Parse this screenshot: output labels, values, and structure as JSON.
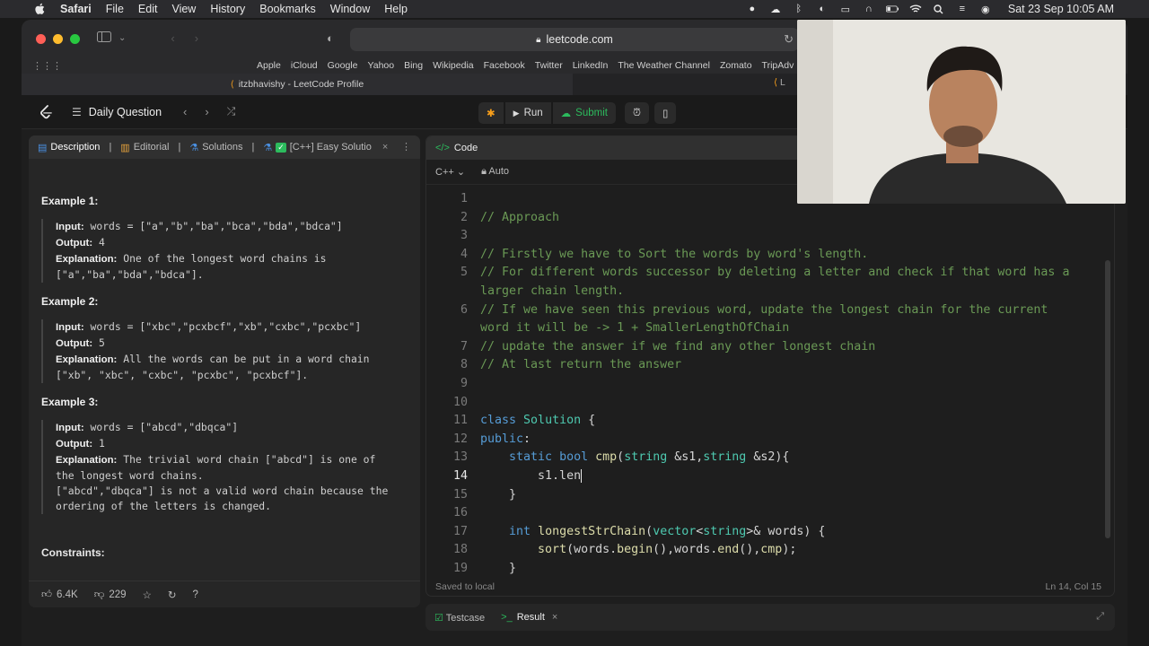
{
  "menubar": {
    "app": "Safari",
    "items": [
      "File",
      "Edit",
      "View",
      "History",
      "Bookmarks",
      "Window",
      "Help"
    ],
    "datetime": "Sat 23 Sep  10:05 AM"
  },
  "browser": {
    "url": "leetcode.com",
    "favorites": [
      "Apple",
      "iCloud",
      "Google",
      "Yahoo",
      "Bing",
      "Wikipedia",
      "Facebook",
      "Twitter",
      "LinkedIn",
      "The Weather Channel",
      "Zomato",
      "TripAdv"
    ],
    "tab_active": "itzbhavishy - LeetCode Profile",
    "tab_other": "L"
  },
  "leetcode": {
    "daily_question": "Daily Question",
    "run_label": "Run",
    "submit_label": "Submit",
    "left_tabs": {
      "description": "Description",
      "editorial": "Editorial",
      "solutions": "Solutions",
      "solution_tab": "[C++] Easy Solutio"
    },
    "examples": [
      {
        "title": "Example 1:",
        "input_label": "Input:",
        "input": " words = [\"a\",\"b\",\"ba\",\"bca\",\"bda\",\"bdca\"]",
        "output_label": "Output:",
        "output": " 4",
        "expl_label": "Explanation:",
        "explanation_l1": " One of the longest word chains is",
        "explanation_l2": "[\"a\",\"ba\",\"bda\",\"bdca\"]."
      },
      {
        "title": "Example 2:",
        "input_label": "Input:",
        "input": " words = [\"xbc\",\"pcxbcf\",\"xb\",\"cxbc\",\"pcxbc\"]",
        "output_label": "Output:",
        "output": " 5",
        "expl_label": "Explanation:",
        "explanation_l1": " All the words can be put in a word chain",
        "explanation_l2": "[\"xb\", \"xbc\", \"cxbc\", \"pcxbc\", \"pcxbcf\"]."
      },
      {
        "title": "Example 3:",
        "input_label": "Input:",
        "input": " words = [\"abcd\",\"dbqca\"]",
        "output_label": "Output:",
        "output": " 1",
        "expl_label": "Explanation:",
        "explanation_l1": " The trivial word chain [\"abcd\"] is one of",
        "explanation_l2": "the longest word chains.",
        "explanation_l3": "[\"abcd\",\"dbqca\"] is not a valid word chain because the",
        "explanation_l4": "ordering of the letters is changed."
      }
    ],
    "constraints_title": "Constraints:",
    "likes": "6.4K",
    "dislikes": "229",
    "code_panel_title": "Code",
    "language": "C++",
    "auto_label": "Auto",
    "status_saved": "Saved to local",
    "status_pos": "Ln 14, Col 15",
    "bottom_tabs": {
      "testcase": "Testcase",
      "result": "Result"
    },
    "code_lines": [
      "",
      "// Approach",
      "",
      "// Firstly we have to Sort the words by word's length.",
      "// For different words successor by deleting a letter and check if that word has a",
      "larger chain length.",
      "// If we have seen this previous word, update the longest chain for the current",
      "word it will be -> 1 + SmallerLengthOfChain",
      "// update the answer if we find any other longest chain",
      "// At last return the answer",
      "",
      "",
      "class Solution {",
      "public:",
      "    static bool cmp(string &s1,string &s2){",
      "        s1.len",
      "    }",
      "",
      "    int longestStrChain(vector<string>& words) {",
      "        sort(words.begin(),words.end(),cmp);",
      "    }"
    ],
    "gutter": [
      "1",
      "2",
      "3",
      "4",
      "5",
      "",
      "6",
      "",
      "7",
      "8",
      "9",
      "10",
      "11",
      "12",
      "13",
      "14",
      "15",
      "16",
      "17",
      "18",
      "19"
    ]
  }
}
